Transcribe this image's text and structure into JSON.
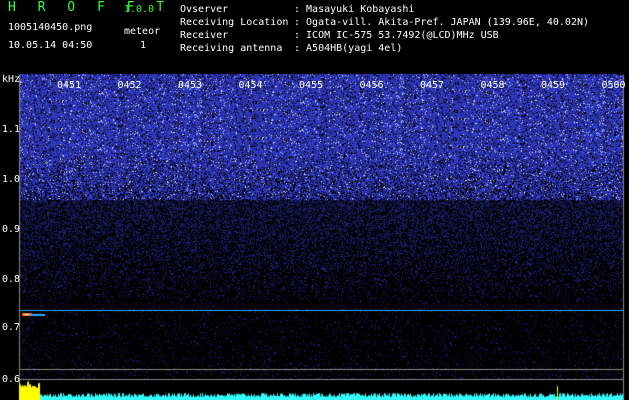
{
  "app": {
    "title": "H R O F F T",
    "version": "1.0.0"
  },
  "header": {
    "filename": "1005140450.png",
    "datetime": "10.05.14 04:50",
    "meteor_label": "meteor",
    "meteor_count": "1"
  },
  "station_info": [
    {
      "label": "Ovserver",
      "value": ": Masayuki Kobayashi"
    },
    {
      "label": "Receiving Location",
      "value": ": Ogata-vill. Akita-Pref. JAPAN (139.96E, 40.02N)"
    },
    {
      "label": "Receiver",
      "value": ": ICOM IC-575 53.7492(@LCD)MHz USB"
    },
    {
      "label": "Receiving antenna",
      "value": ": A504HB(yagi 4el)"
    }
  ],
  "spectrogram": {
    "freq_unit": "kHz",
    "freq_ticks": [
      "1.1",
      "1.0",
      "0.9",
      "0.8",
      "0.7",
      "0.6"
    ],
    "time_ticks": [
      "0451",
      "0452",
      "0453",
      "0454",
      "0455",
      "0456",
      "0457",
      "0458",
      "0459",
      "0500"
    ],
    "colors": {
      "noise_strong": "#2a3aff",
      "noise_weak": "#0a1050",
      "carrier": "#33aaff",
      "echo": "#ff6633",
      "level": "#33ffff",
      "level_peak": "#ffff00",
      "grid": "#888888"
    }
  }
}
